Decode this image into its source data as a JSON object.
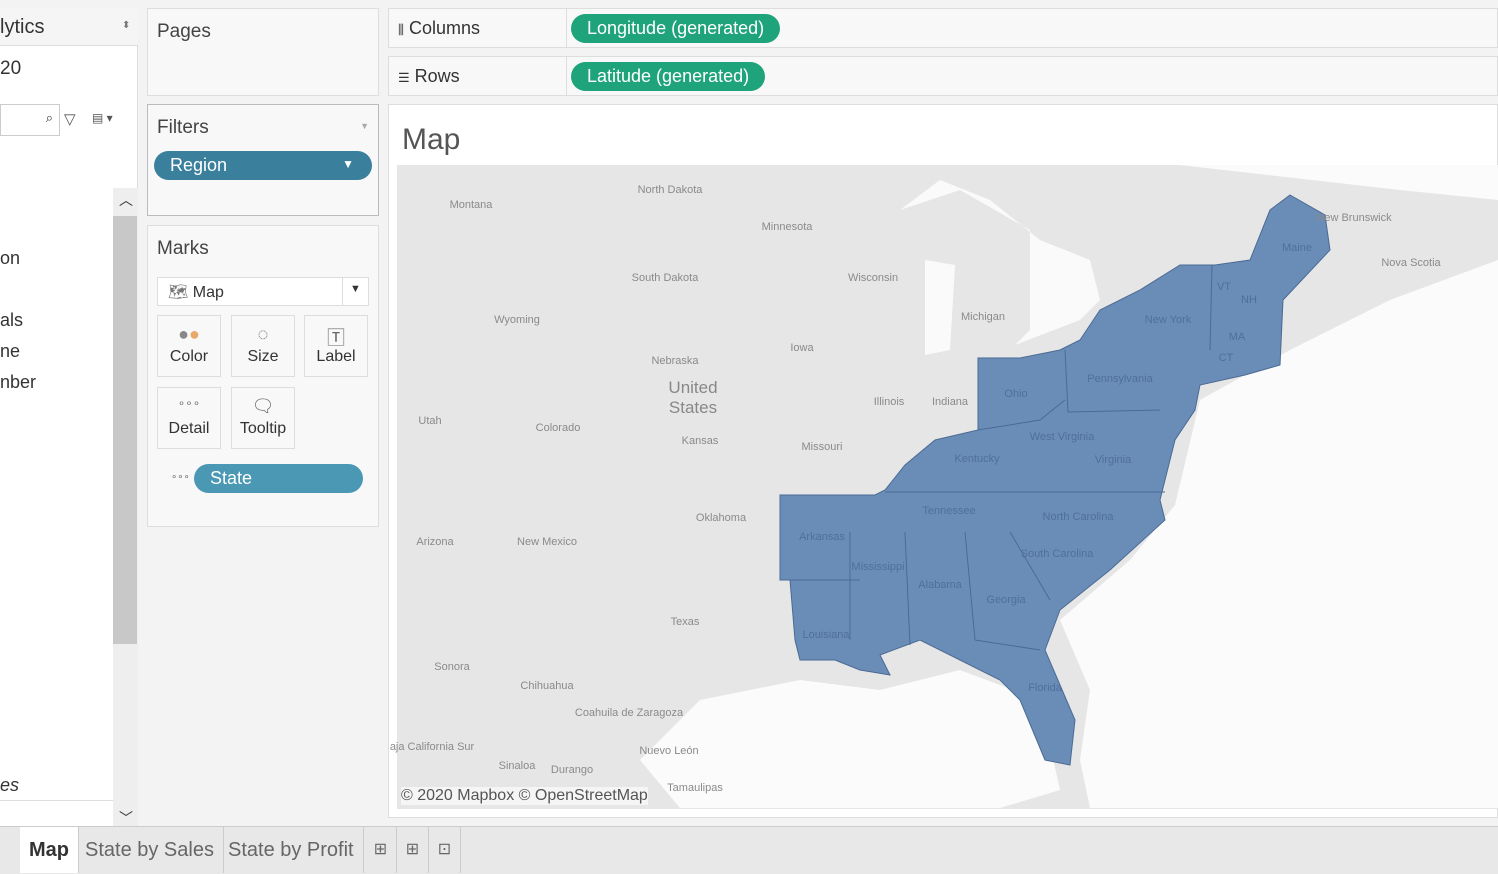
{
  "left_panel": {
    "title": "lytics",
    "source": "20",
    "fields": [
      "on",
      "als",
      "ne",
      "nber"
    ],
    "footer": "es"
  },
  "pages": {
    "title": "Pages"
  },
  "filters": {
    "title": "Filters",
    "pills": [
      "Region"
    ]
  },
  "marks": {
    "title": "Marks",
    "type": "Map",
    "buttons": [
      "Color",
      "Size",
      "Label",
      "Detail",
      "Tooltip"
    ],
    "fields": [
      "State"
    ]
  },
  "shelves": {
    "columns_label": "Columns",
    "columns_pill": "Longitude (generated)",
    "rows_label": "Rows",
    "rows_pill": "Latitude (generated)"
  },
  "view": {
    "title": "Map",
    "attribution": "© 2020 Mapbox © OpenStreetMap",
    "gray_labels": [
      "Montana",
      "North Dakota",
      "Minnesota",
      "South Dakota",
      "Wisconsin",
      "Michigan",
      "Wyoming",
      "Nebraska",
      "Iowa",
      "Utah",
      "Colorado",
      "Kansas",
      "Illinois",
      "Indiana",
      "Missouri",
      "Oklahoma",
      "Arizona",
      "New Mexico",
      "Texas",
      "Sonora",
      "Chihuahua",
      "Coahuila de Zaragoza",
      "aja California Sur",
      "Sinaloa",
      "Durango",
      "Nuevo León",
      "Tamaulipas",
      "New Brunswick",
      "Nova Scotia"
    ],
    "country_label": "United States",
    "highlighted_labels": [
      "Maine",
      "New York",
      "Pennsylvania",
      "Ohio",
      "West Virginia",
      "Virginia",
      "Kentucky",
      "Tennessee",
      "North Carolina",
      "South Carolina",
      "Georgia",
      "Alabama",
      "Mississippi",
      "Arkansas",
      "Louisiana",
      "Florida",
      "VT",
      "NH",
      "MA",
      "CT"
    ],
    "highlight_color": "#6a8db8"
  },
  "tabs": [
    "Map",
    "State by Sales",
    "State by Profit"
  ],
  "colors": {
    "filter_pill": "#3a7f9c",
    "detail_pill": "#4a98b4",
    "axis_pill": "#1fa37a"
  }
}
